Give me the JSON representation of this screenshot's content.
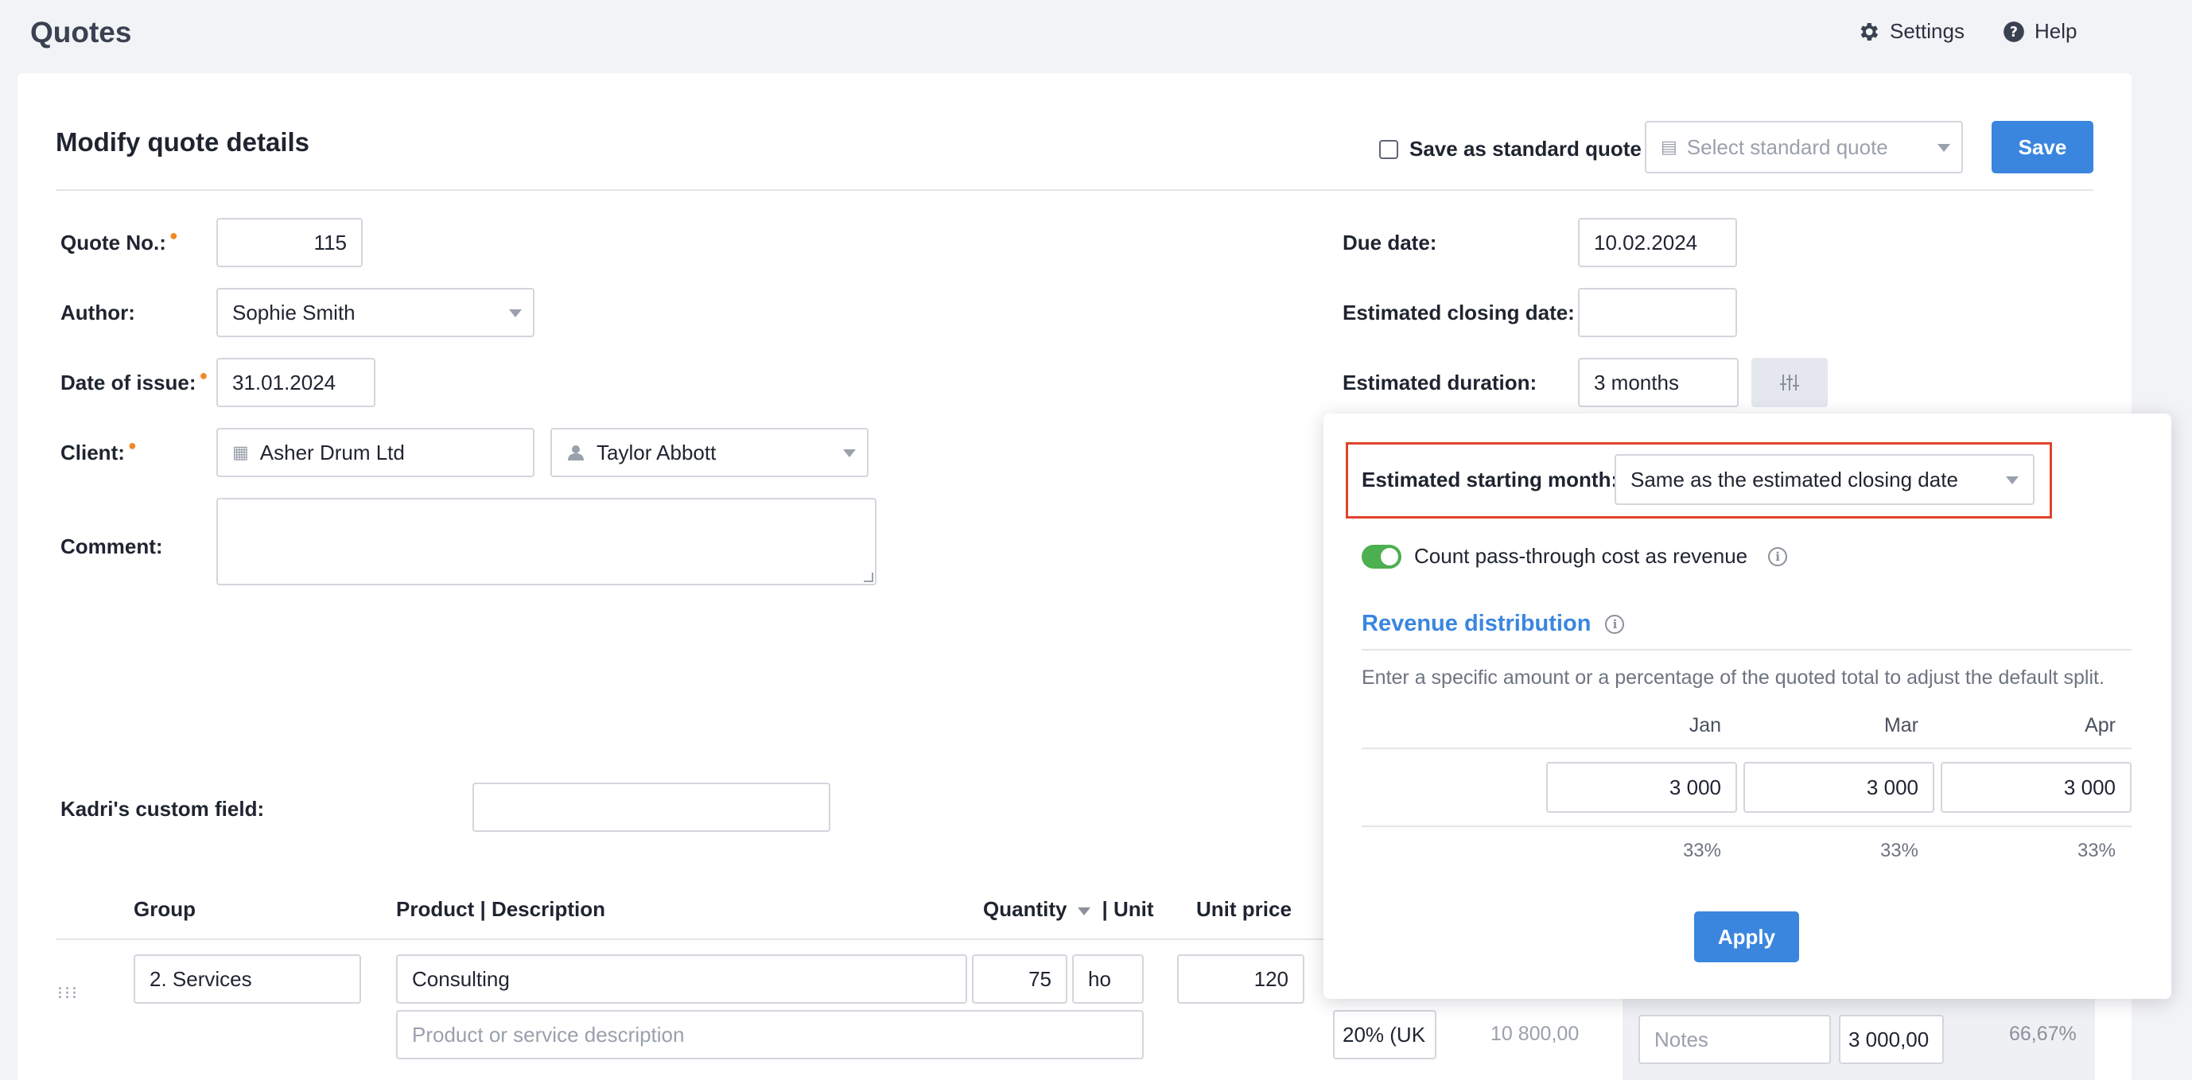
{
  "header": {
    "title": "Quotes",
    "settings_label": "Settings",
    "help_label": "Help"
  },
  "form": {
    "title": "Modify quote details",
    "save_as_standard_label": "Save as standard quote",
    "select_standard_placeholder": "Select standard quote",
    "save_label": "Save",
    "quote_no_label": "Quote No.:",
    "quote_no_value": "115",
    "author_label": "Author:",
    "author_value": "Sophie Smith",
    "date_of_issue_label": "Date of issue:",
    "date_of_issue_value": "31.01.2024",
    "client_label": "Client:",
    "client_company": "Asher Drum Ltd",
    "client_contact": "Taylor Abbott",
    "comment_label": "Comment:",
    "comment_value": "",
    "due_date_label": "Due date:",
    "due_date_value": "10.02.2024",
    "est_closing_label": "Estimated closing date:",
    "est_closing_value": "",
    "est_duration_label": "Estimated duration:",
    "est_duration_value": "3 months",
    "custom_field_label": "Kadri's custom field:",
    "custom_field_value": ""
  },
  "table": {
    "headers": {
      "group": "Group",
      "product": "Product | Description",
      "quantity": "Quantity",
      "unit": "| Unit",
      "unit_price": "Unit price"
    },
    "row": {
      "group": "2. Services",
      "product": "Consulting",
      "description_placeholder": "Product or service description",
      "quantity": "75",
      "unit": "ho",
      "unit_price": "120",
      "vat": "20% (UK",
      "total": "10 800,00",
      "notes_placeholder": "Notes",
      "cost": "3 000,00",
      "margin": "66,67%"
    }
  },
  "popover": {
    "starting_month_label": "Estimated starting month:",
    "starting_month_value": "Same as the estimated closing date",
    "pass_through_label": "Count pass-through cost as revenue",
    "revenue_title": "Revenue distribution",
    "revenue_hint": "Enter a specific amount or a percentage of the quoted total to adjust the default split.",
    "months": [
      {
        "name": "Jan",
        "amount": "3 000",
        "pct": "33%"
      },
      {
        "name": "Mar",
        "amount": "3 000",
        "pct": "33%"
      },
      {
        "name": "Apr",
        "amount": "3 000",
        "pct": "33%"
      }
    ],
    "apply_label": "Apply"
  },
  "colors": {
    "primary": "#3a86df",
    "highlight": "#e0432b",
    "toggle_on": "#4caf50",
    "required": "#f08a24"
  }
}
